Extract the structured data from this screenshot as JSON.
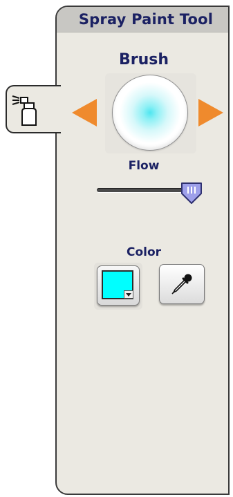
{
  "panel": {
    "title": "Spray Paint Tool"
  },
  "tab": {
    "icon": "spray-can-icon"
  },
  "brush": {
    "label": "Brush",
    "prev_icon": "arrow-left-icon",
    "next_icon": "arrow-right-icon"
  },
  "flow": {
    "label": "Flow",
    "value_fraction": 0.9
  },
  "color": {
    "label": "Color",
    "value": "#00ffff",
    "eyedropper_icon": "eyedropper-icon"
  },
  "colors": {
    "accent_orange": "#ef8a2d",
    "title_navy": "#1b2163",
    "panel_bg": "#ebe9e2",
    "header_bg": "#c8c7c3",
    "slider_thumb": "#9ea0ea"
  }
}
